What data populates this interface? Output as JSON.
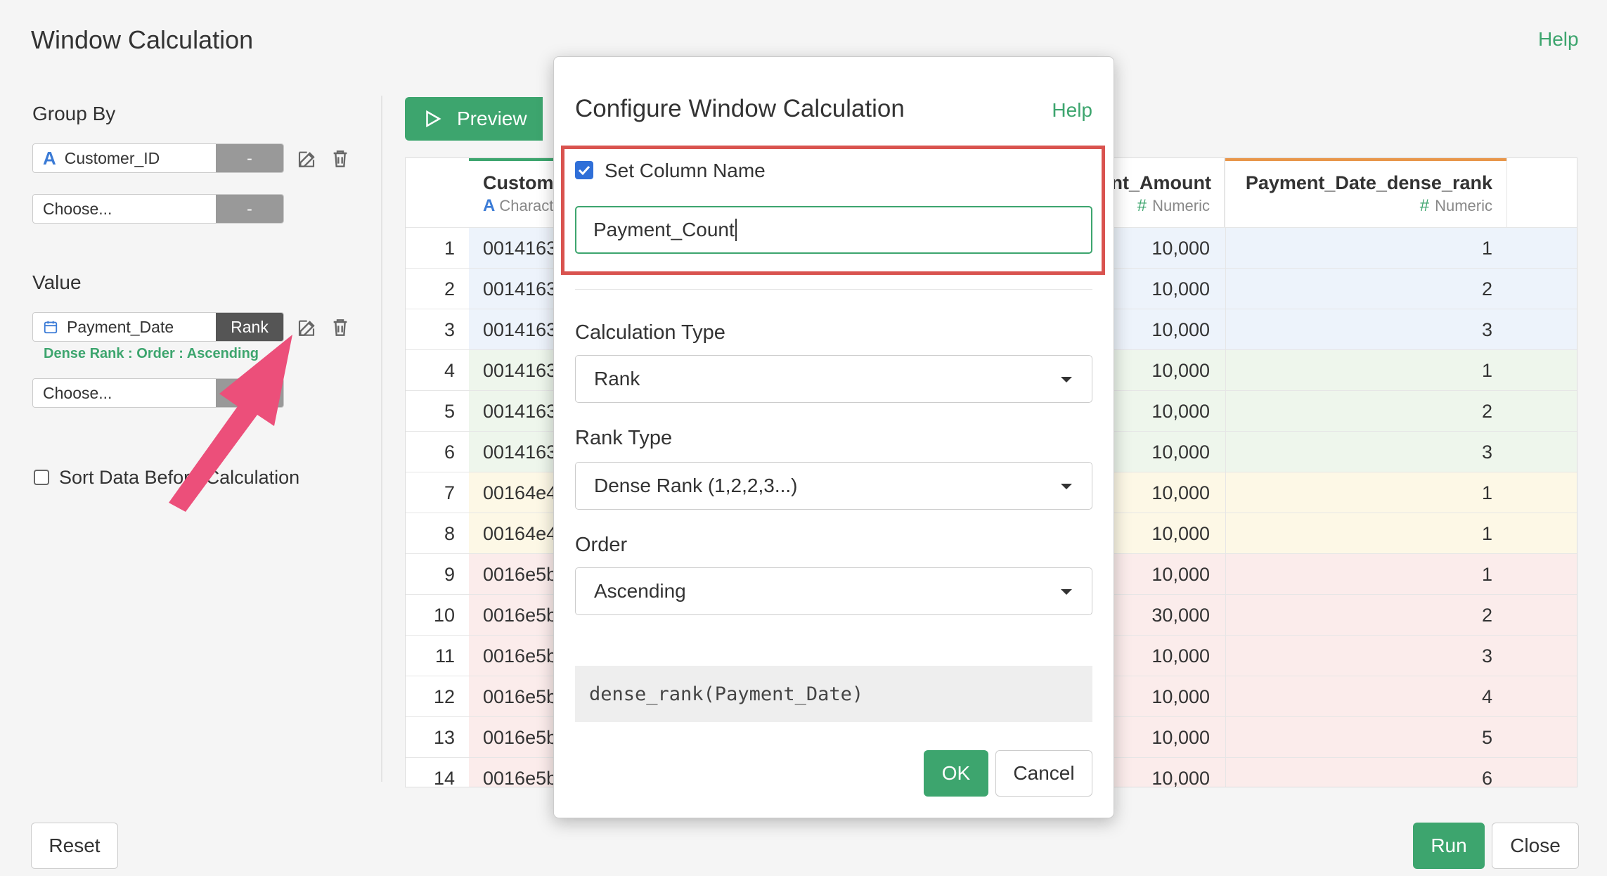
{
  "page": {
    "title": "Window Calculation",
    "help": "Help"
  },
  "left_panel": {
    "group_by_label": "Group By",
    "group_by_items": [
      {
        "name": "Customer_ID",
        "tag": "-",
        "icon": "character-type-icon"
      },
      {
        "name": "Choose...",
        "tag": "-"
      }
    ],
    "value_label": "Value",
    "value_items": [
      {
        "name": "Payment_Date",
        "tag": "Rank",
        "icon": "calendar-icon",
        "subtitle": "Dense Rank : Order : Ascending"
      },
      {
        "name": "Choose...",
        "tag": ""
      }
    ],
    "sort_label": "Sort Data Before Calculation",
    "sort_checked": false
  },
  "toolbar": {
    "preview_label": "Preview"
  },
  "table": {
    "columns": [
      {
        "title": "Customer_ID",
        "type": "Character",
        "accent": "#3da56e"
      },
      {
        "title": "Payment_Amount",
        "type": "Numeric"
      },
      {
        "title": "Payment_Date_dense_rank",
        "type": "Numeric",
        "accent": "#e8964a"
      }
    ],
    "rows": [
      {
        "num": "1",
        "id": "00141631",
        "amount": "10,000",
        "rank": "1",
        "color": "#edf3fb"
      },
      {
        "num": "2",
        "id": "00141631",
        "amount": "10,000",
        "rank": "2",
        "color": "#edf3fb"
      },
      {
        "num": "3",
        "id": "00141631",
        "amount": "10,000",
        "rank": "3",
        "color": "#edf3fb"
      },
      {
        "num": "4",
        "id": "00141632",
        "amount": "10,000",
        "rank": "1",
        "color": "#eef6ec"
      },
      {
        "num": "5",
        "id": "00141632",
        "amount": "10,000",
        "rank": "2",
        "color": "#eef6ec"
      },
      {
        "num": "6",
        "id": "00141632",
        "amount": "10,000",
        "rank": "3",
        "color": "#eef6ec"
      },
      {
        "num": "7",
        "id": "00164e4a",
        "amount": "10,000",
        "rank": "1",
        "color": "#fdf8e6"
      },
      {
        "num": "8",
        "id": "00164e4b",
        "amount": "10,000",
        "rank": "1",
        "color": "#fdf8e6"
      },
      {
        "num": "9",
        "id": "0016e5b1",
        "amount": "10,000",
        "rank": "1",
        "color": "#fbeceb"
      },
      {
        "num": "10",
        "id": "0016e5b2",
        "amount": "30,000",
        "rank": "2",
        "color": "#fbeceb"
      },
      {
        "num": "11",
        "id": "0016e5b2",
        "amount": "10,000",
        "rank": "3",
        "color": "#fbeceb"
      },
      {
        "num": "12",
        "id": "0016e5b2",
        "amount": "10,000",
        "rank": "4",
        "color": "#fbeceb"
      },
      {
        "num": "13",
        "id": "0016e5b2",
        "amount": "10,000",
        "rank": "5",
        "color": "#fbeceb"
      },
      {
        "num": "14",
        "id": "0016e5b2",
        "amount": "10,000",
        "rank": "6",
        "color": "#fbeceb"
      }
    ]
  },
  "footer": {
    "reset_label": "Reset",
    "run_label": "Run",
    "close_label": "Close"
  },
  "modal": {
    "title": "Configure Window Calculation",
    "help": "Help",
    "set_column_name_label": "Set Column Name",
    "set_column_name_checked": true,
    "column_name_value": "Payment_Count",
    "calc_type_label": "Calculation Type",
    "calc_type_value": "Rank",
    "rank_type_label": "Rank Type",
    "rank_type_value": "Dense Rank (1,2,2,3...)",
    "order_label": "Order",
    "order_value": "Ascending",
    "expression": "dense_rank(Payment_Date)",
    "ok_label": "OK",
    "cancel_label": "Cancel"
  },
  "colors": {
    "accent_green": "#3da56e",
    "highlight_red": "#d9534f",
    "arrow_pink": "#ec4f7a"
  }
}
